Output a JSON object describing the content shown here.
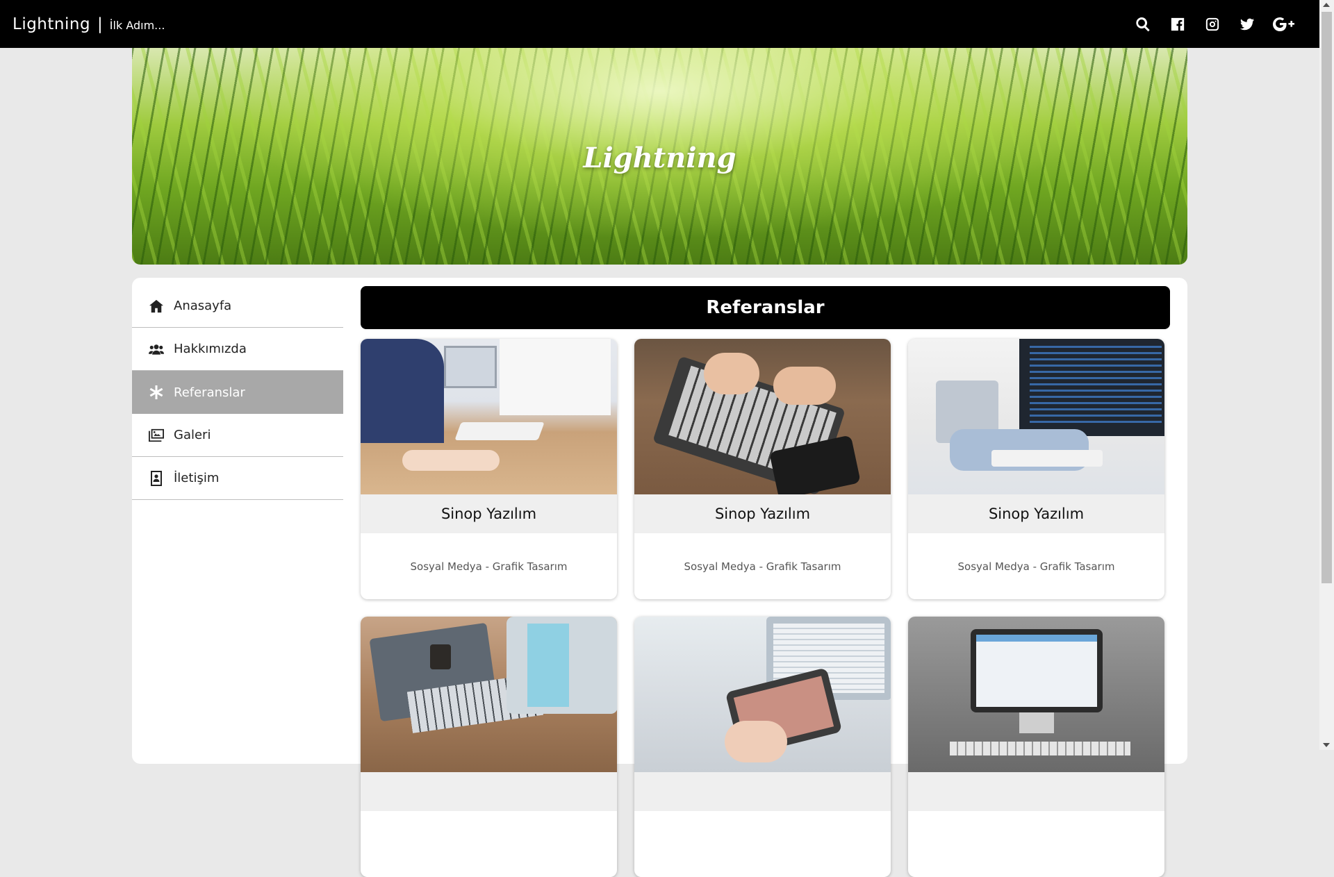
{
  "topbar": {
    "brand_name": "Lightning",
    "brand_sep": "|",
    "brand_tagline": "İlk Adım...",
    "icons": [
      "search-icon",
      "facebook-icon",
      "instagram-icon",
      "twitter-icon",
      "google-plus-icon"
    ]
  },
  "hero": {
    "title": "Lightning"
  },
  "sidebar": {
    "items": [
      {
        "label": "Anasayfa",
        "icon": "home-icon"
      },
      {
        "label": "Hakkımızda",
        "icon": "users-icon"
      },
      {
        "label": "Referanslar",
        "icon": "asterisk-icon",
        "active": true
      },
      {
        "label": "Galeri",
        "icon": "images-icon"
      },
      {
        "label": "İletişim",
        "icon": "contact-book-icon"
      }
    ]
  },
  "main": {
    "section_title": "Referanslar",
    "cards": [
      {
        "title": "Sinop Yazılım",
        "subtitle": "Sosyal Medya - Grafik Tasarım"
      },
      {
        "title": "Sinop Yazılım",
        "subtitle": "Sosyal Medya - Grafik Tasarım"
      },
      {
        "title": "Sinop Yazılım",
        "subtitle": "Sosyal Medya - Grafik Tasarım"
      },
      {
        "title": "",
        "subtitle": ""
      },
      {
        "title": "",
        "subtitle": ""
      },
      {
        "title": "",
        "subtitle": ""
      }
    ]
  },
  "colors": {
    "navbar_bg": "#000000",
    "page_bg": "#e9e9e9",
    "active_item_bg": "#a8a8a8",
    "card_title_bg": "#efefef"
  }
}
